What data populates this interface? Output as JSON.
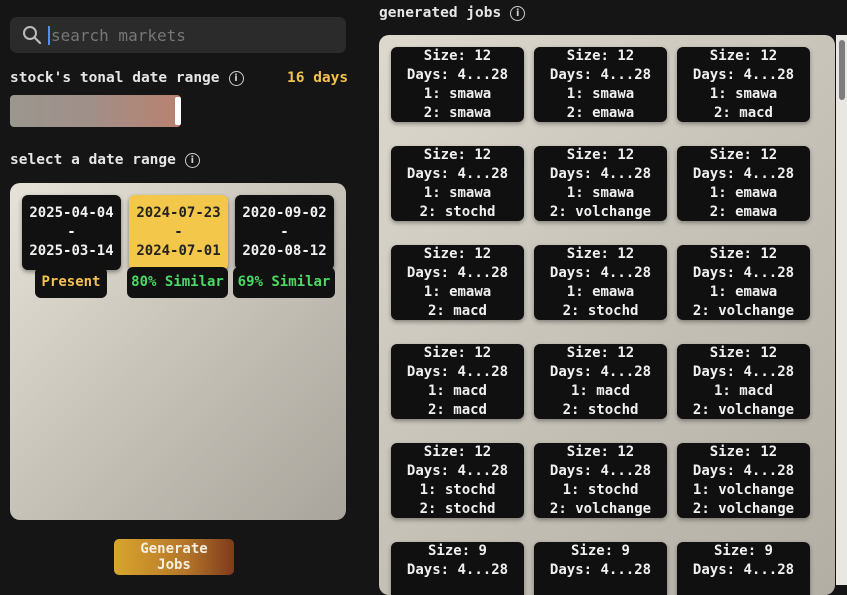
{
  "search": {
    "placeholder": "search markets",
    "icon": "magnifier-icon"
  },
  "tonal": {
    "label": "stock's tonal date range",
    "days": "16 days",
    "slider_value": 1.0
  },
  "date_range": {
    "label": "select a date range",
    "options": [
      {
        "start": "2025-04-04",
        "sep": "-",
        "end": "2025-03-14",
        "badge": "Present",
        "selected": false
      },
      {
        "start": "2024-07-23",
        "sep": "-",
        "end": "2024-07-01",
        "badge": "80% Similar",
        "selected": true
      },
      {
        "start": "2020-09-02",
        "sep": "-",
        "end": "2020-08-12",
        "badge": "69% Similar",
        "selected": false
      }
    ]
  },
  "generate_button": "Generate Jobs",
  "jobs": {
    "title": "generated jobs",
    "items": [
      {
        "size": "Size: 12",
        "days": "Days: 4...28",
        "one": "1: smawa",
        "two": "2: smawa"
      },
      {
        "size": "Size: 12",
        "days": "Days: 4...28",
        "one": "1: smawa",
        "two": "2: emawa"
      },
      {
        "size": "Size: 12",
        "days": "Days: 4...28",
        "one": "1: smawa",
        "two": "2: macd"
      },
      {
        "size": "Size: 12",
        "days": "Days: 4...28",
        "one": "1: smawa",
        "two": "2: stochd"
      },
      {
        "size": "Size: 12",
        "days": "Days: 4...28",
        "one": "1: smawa",
        "two": "2: volchange"
      },
      {
        "size": "Size: 12",
        "days": "Days: 4...28",
        "one": "1: emawa",
        "two": "2: emawa"
      },
      {
        "size": "Size: 12",
        "days": "Days: 4...28",
        "one": "1: emawa",
        "two": "2: macd"
      },
      {
        "size": "Size: 12",
        "days": "Days: 4...28",
        "one": "1: emawa",
        "two": "2: stochd"
      },
      {
        "size": "Size: 12",
        "days": "Days: 4...28",
        "one": "1: emawa",
        "two": "2: volchange"
      },
      {
        "size": "Size: 12",
        "days": "Days: 4...28",
        "one": "1: macd",
        "two": "2: macd"
      },
      {
        "size": "Size: 12",
        "days": "Days: 4...28",
        "one": "1: macd",
        "two": "2: stochd"
      },
      {
        "size": "Size: 12",
        "days": "Days: 4...28",
        "one": "1: macd",
        "two": "2: volchange"
      },
      {
        "size": "Size: 12",
        "days": "Days: 4...28",
        "one": "1: stochd",
        "two": "2: stochd"
      },
      {
        "size": "Size: 12",
        "days": "Days: 4...28",
        "one": "1: stochd",
        "two": "2: volchange"
      },
      {
        "size": "Size: 12",
        "days": "Days: 4...28",
        "one": "1: volchange",
        "two": "2: volchange"
      },
      {
        "size": "Size: 9",
        "days": "Days: 4...28",
        "one": "",
        "two": ""
      },
      {
        "size": "Size: 9",
        "days": "Days: 4...28",
        "one": "",
        "two": ""
      },
      {
        "size": "Size: 9",
        "days": "Days: 4...28",
        "one": "",
        "two": ""
      }
    ]
  },
  "colors": {
    "accent_yellow": "#f3c84a",
    "similar_green": "#4cd964",
    "days_orange": "#f2c14e"
  }
}
